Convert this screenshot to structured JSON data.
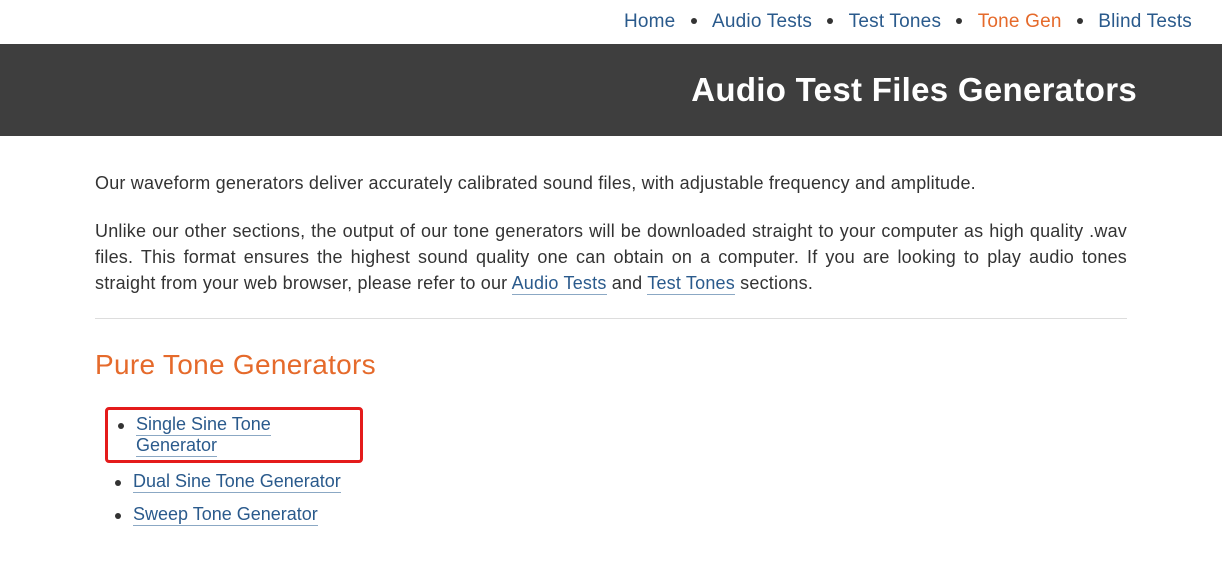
{
  "nav": {
    "items": [
      {
        "label": "Home",
        "active": false
      },
      {
        "label": "Audio Tests",
        "active": false
      },
      {
        "label": "Test Tones",
        "active": false
      },
      {
        "label": "Tone Gen",
        "active": true
      },
      {
        "label": "Blind Tests",
        "active": false
      }
    ]
  },
  "banner": {
    "title": "Audio Test Files Generators"
  },
  "intro": {
    "p1": "Our waveform generators deliver accurately calibrated sound files, with adjustable frequency and amplitude.",
    "p2_a": "Unlike our other sections, the output of our tone generators will be downloaded straight to your computer as high quality .wav files. This format ensures the highest sound quality one can obtain on a computer. If you are looking to play audio tones straight from your web browser, please refer to our ",
    "p2_link1": "Audio Tests",
    "p2_b": " and ",
    "p2_link2": "Test Tones",
    "p2_c": " sections."
  },
  "section": {
    "title": "Pure Tone Generators",
    "items": [
      {
        "label": "Single Sine Tone Generator",
        "highlighted": true
      },
      {
        "label": "Dual Sine Tone Generator",
        "highlighted": false
      },
      {
        "label": "Sweep Tone Generator",
        "highlighted": false
      }
    ]
  }
}
